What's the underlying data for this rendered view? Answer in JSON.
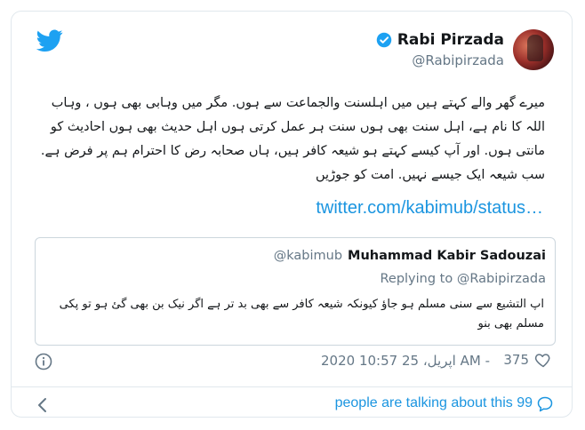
{
  "author": {
    "display_name": "Rabi Pirzada",
    "handle": "@Rabipirzada"
  },
  "tweet": {
    "text": "میرے گھر والے کہتے ہیں میں اہلسنت والجماعت سے ہوں. مگر میں وہابی بھی ہوں ، وہاب اللہ کا نام ہے، اہل سنت بھی ہوں سنت ہر عمل کرتی ہوں اہل حدیث بھی ہوں احادیث کو مانتی ہوں. اور آپ کیسے کہتے ہو شیعہ کافر ہیں، ہاں صحابہ رض کا احترام ہم پر فرض ہے. سب شیعہ ایک جیسے نہیں. امت کو جوڑیں",
    "link": "twitter.com/kabimub/status…"
  },
  "quoted_tweet": {
    "author_name": "Muhammad Kabir Sadouzai",
    "handle": "@kabimub",
    "replying_to_label": "Replying to",
    "replying_to_handle": "@Rabipirzada",
    "text": "اپ التشیع سے سنی مسلم ہو جاؤ کیونکہ شیعہ کافر سے بھی بد تر ہے اگر نیک بن بھی گئ ہو تو پکی مسلم بھی بنو"
  },
  "meta": {
    "timestamp": "2020 اپریل، 25 10:57 AM -",
    "likes": "375"
  },
  "footer": {
    "talking_text": "people are talking about this 99"
  },
  "colors": {
    "accent": "#1b95e0",
    "twitter_blue": "#1da1f2",
    "secondary_text": "#657786",
    "border": "#e1e8ed"
  },
  "icons": {
    "brand": "twitter-bird-icon",
    "verified": "verified-badge-icon",
    "info": "info-icon",
    "like": "heart-icon",
    "back": "chevron-left-icon",
    "comment": "speech-bubble-icon"
  }
}
